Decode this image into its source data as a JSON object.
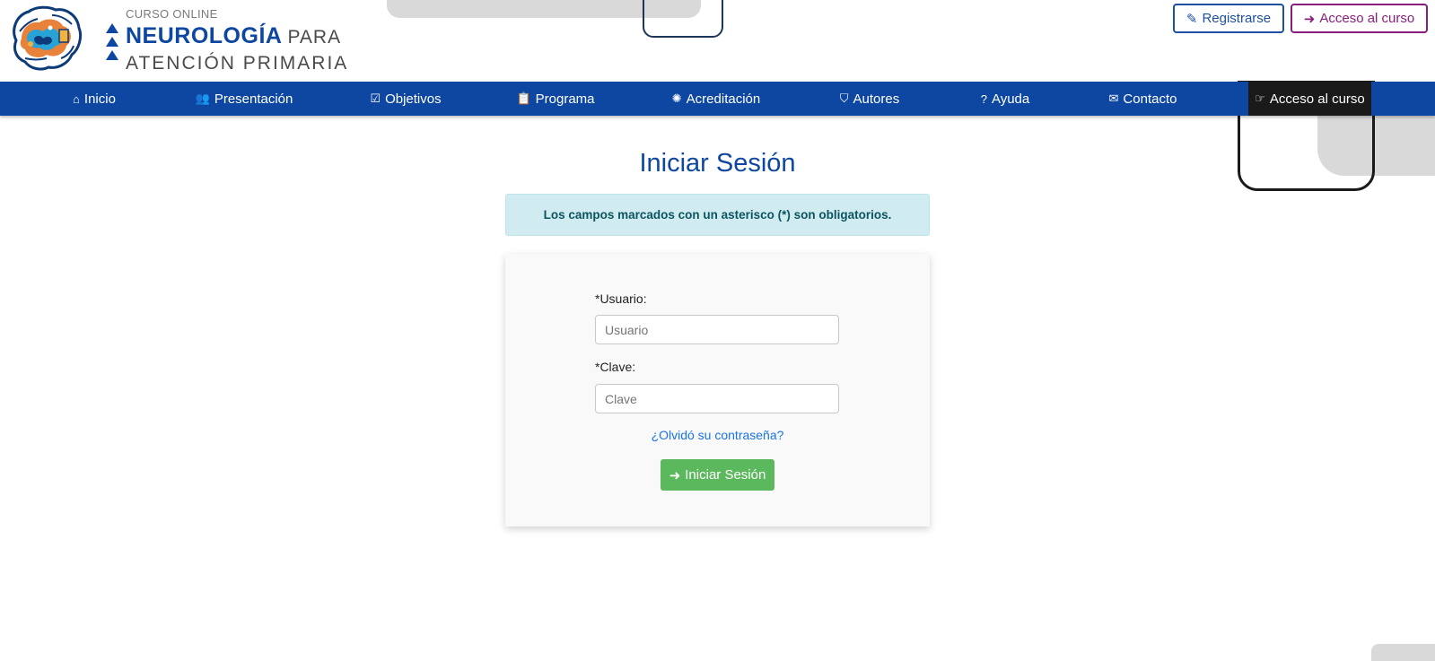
{
  "header": {
    "brand": {
      "subtitle": "CURSO ONLINE",
      "title_main": "NEUROLOGÍA",
      "title_para": "PARA",
      "title_line2": "ATENCIÓN  PRIMARIA"
    },
    "register_button": {
      "icon": "pencil-icon",
      "label": "Registrarse"
    },
    "access_button": {
      "icon": "sign-in-icon",
      "label": "Acceso al curso"
    }
  },
  "nav": {
    "items": [
      {
        "icon": "home-icon",
        "glyph": "⌂",
        "label": "Inicio"
      },
      {
        "icon": "users-icon",
        "glyph": "👥",
        "label": "Presentación"
      },
      {
        "icon": "check-square-icon",
        "glyph": "☑",
        "label": "Objetivos"
      },
      {
        "icon": "calendar-check-icon",
        "glyph": "📋",
        "label": "Programa"
      },
      {
        "icon": "certificate-icon",
        "glyph": "✺",
        "label": "Acreditación"
      },
      {
        "icon": "shield-icon",
        "glyph": "⛉",
        "label": "Autores"
      },
      {
        "icon": "question-circle-icon",
        "glyph": "?",
        "label": "Ayuda"
      },
      {
        "icon": "envelope-icon",
        "glyph": "✉",
        "label": "Contacto"
      },
      {
        "icon": "hand-pointer-icon",
        "glyph": "☞",
        "label": "Acceso al curso",
        "active": true
      }
    ]
  },
  "login": {
    "title": "Iniciar Sesión",
    "notice": "Los campos marcados con un asterisco (*) son obligatorios.",
    "username_label": "*Usuario:",
    "username_placeholder": "Usuario",
    "username_value": "",
    "password_label": "*Clave:",
    "password_placeholder": "Clave",
    "password_value": "",
    "forgot_link": "¿Olvidó su contraseña?",
    "submit_icon": "sign-in-icon",
    "submit_label": "Iniciar Sesión"
  },
  "colors": {
    "primary": "#0d47a1",
    "register_border": "#1e4fa0",
    "access_border": "#8b1e7d",
    "nav_active": "#1a1a1a",
    "alert_bg": "#d1ecf1",
    "alert_text": "#0c5460",
    "submit_bg": "#5cb85c",
    "link": "#1a73e8"
  }
}
